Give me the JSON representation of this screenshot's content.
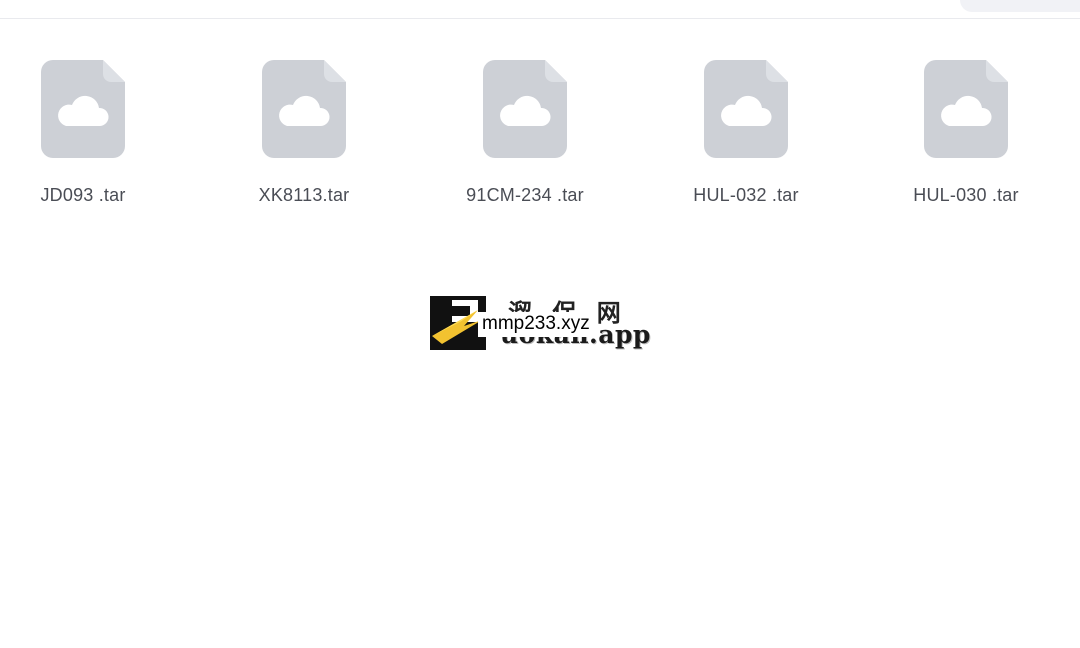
{
  "colors": {
    "file_icon": "#cdd0d6",
    "file_icon_fold": "#dde0e5",
    "cloud": "#ffffff",
    "file_name_text": "#4a4d55",
    "divider": "#e9eaee"
  },
  "files": [
    {
      "name": "JD093 .tar",
      "icon": "cloud-file-icon"
    },
    {
      "name": "XK8113.tar",
      "icon": "cloud-file-icon"
    },
    {
      "name": "91CM-234 .tar",
      "icon": "cloud-file-icon"
    },
    {
      "name": "HUL-032 .tar",
      "icon": "cloud-file-icon"
    },
    {
      "name": "HUL-030 .tar",
      "icon": "cloud-file-icon"
    }
  ],
  "watermark": {
    "cjk_text": "溜 保 网",
    "brand_text": "uokan.app",
    "url_text": "mmp233.xyz",
    "logo_icon": "p-arrow-logo"
  }
}
